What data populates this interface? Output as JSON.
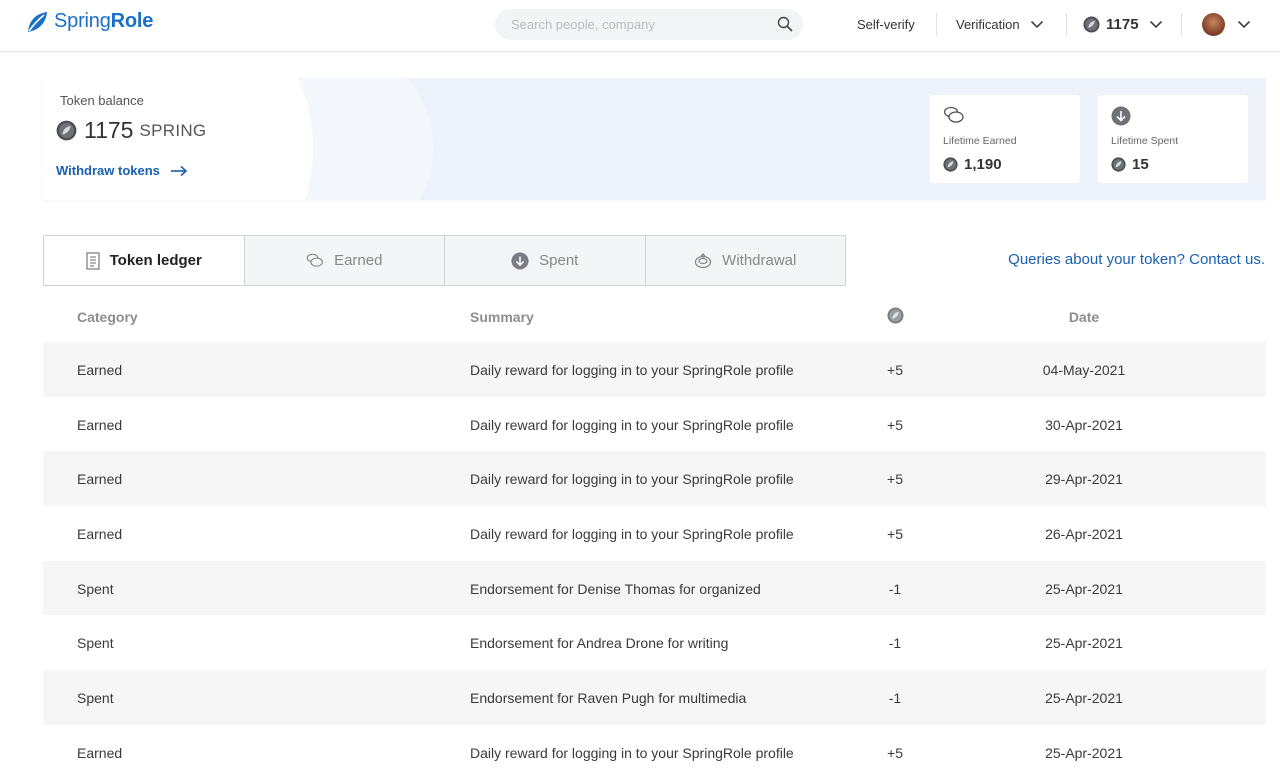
{
  "brand": {
    "name_part1": "Spring",
    "name_part2": "Role",
    "accent": "#1a70c9"
  },
  "search": {
    "placeholder": "Search people, company",
    "value": ""
  },
  "nav": {
    "self_verify": "Self-verify",
    "verification": "Verification",
    "token_count": "1175"
  },
  "balance": {
    "label": "Token balance",
    "amount": "1175",
    "unit": "SPRING",
    "withdraw_label": "Withdraw tokens",
    "lifetime_earned_label": "Lifetime Earned",
    "lifetime_earned_value": "1,190",
    "lifetime_spent_label": "Lifetime Spent",
    "lifetime_spent_value": "15"
  },
  "tabs": [
    {
      "label": "Token ledger",
      "icon": "ledger-icon",
      "active": true
    },
    {
      "label": "Earned",
      "icon": "coins-icon",
      "active": false
    },
    {
      "label": "Spent",
      "icon": "download-circle-icon",
      "active": false
    },
    {
      "label": "Withdrawal",
      "icon": "withdraw-icon",
      "active": false
    }
  ],
  "contact_link": "Queries about your token? Contact us.",
  "table": {
    "headers": {
      "category": "Category",
      "summary": "Summary",
      "amount_icon": "spring-token-icon",
      "date": "Date"
    },
    "rows": [
      {
        "category": "Earned",
        "summary": "Daily reward for logging in to your SpringRole profile",
        "amount": "+5",
        "date": "04-May-2021"
      },
      {
        "category": "Earned",
        "summary": "Daily reward for logging in to your SpringRole profile",
        "amount": "+5",
        "date": "30-Apr-2021"
      },
      {
        "category": "Earned",
        "summary": "Daily reward for logging in to your SpringRole profile",
        "amount": "+5",
        "date": "29-Apr-2021"
      },
      {
        "category": "Earned",
        "summary": "Daily reward for logging in to your SpringRole profile",
        "amount": "+5",
        "date": "26-Apr-2021"
      },
      {
        "category": "Spent",
        "summary": "Endorsement for Denise Thomas for organized",
        "amount": "-1",
        "date": "25-Apr-2021"
      },
      {
        "category": "Spent",
        "summary": "Endorsement for Andrea Drone for writing",
        "amount": "-1",
        "date": "25-Apr-2021"
      },
      {
        "category": "Spent",
        "summary": "Endorsement for Raven Pugh for multimedia",
        "amount": "-1",
        "date": "25-Apr-2021"
      },
      {
        "category": "Earned",
        "summary": "Daily reward for logging in to your SpringRole profile",
        "amount": "+5",
        "date": "25-Apr-2021"
      }
    ]
  }
}
